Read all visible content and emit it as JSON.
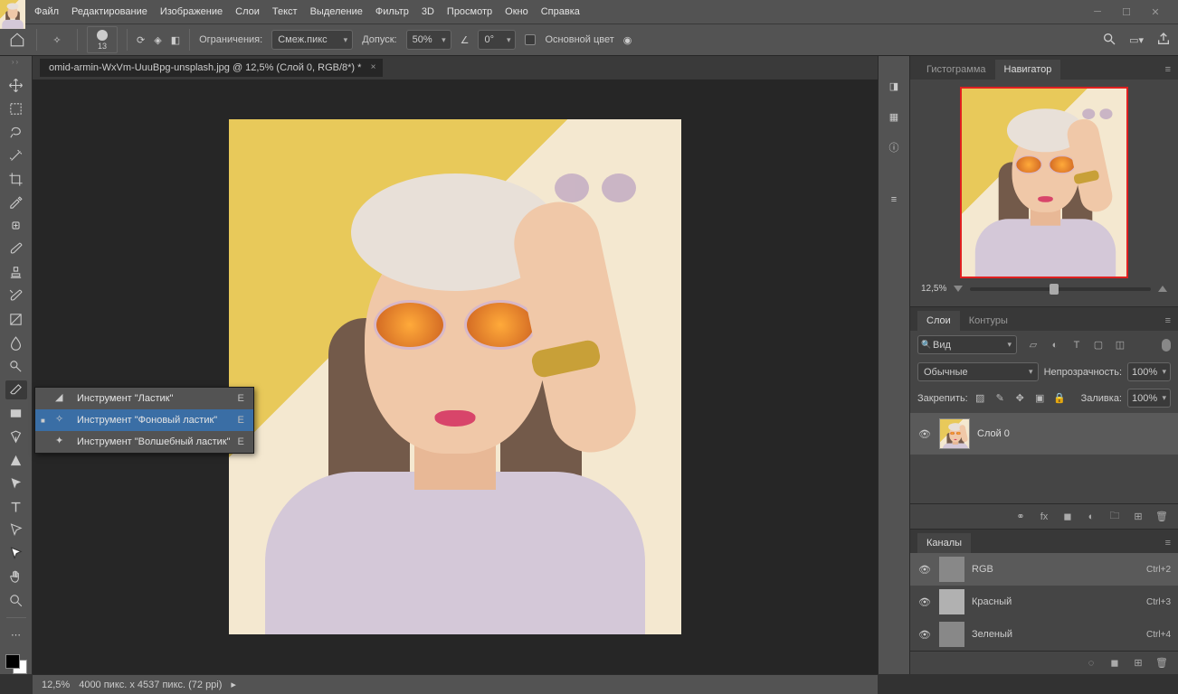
{
  "menu": {
    "items": [
      "Файл",
      "Редактирование",
      "Изображение",
      "Слои",
      "Текст",
      "Выделение",
      "Фильтр",
      "3D",
      "Просмотр",
      "Окно",
      "Справка"
    ]
  },
  "options": {
    "brush_size": "13",
    "limits_label": "Ограничения:",
    "limits_value": "Смеж.пикс",
    "tolerance_label": "Допуск:",
    "tolerance_value": "50%",
    "angle_value": "0°",
    "protect_fg": "Основной цвет"
  },
  "document": {
    "tab_title": "omid-armin-WxVm-UuuBpg-unsplash.jpg @ 12,5% (Слой 0, RGB/8*) *"
  },
  "tool_flyout": {
    "items": [
      {
        "label": "Инструмент \"Ластик\"",
        "key": "E",
        "selected": false
      },
      {
        "label": "Инструмент \"Фоновый ластик\"",
        "key": "E",
        "selected": true
      },
      {
        "label": "Инструмент \"Волшебный ластик\"",
        "key": "E",
        "selected": false
      }
    ]
  },
  "navigator": {
    "tabs": [
      "Гистограмма",
      "Навигатор"
    ],
    "active_tab": 1,
    "zoom": "12,5%"
  },
  "layers": {
    "tabs": [
      "Слои",
      "Контуры"
    ],
    "active_tab": 0,
    "filter_kind": "Вид",
    "blend_mode": "Обычные",
    "opacity_label": "Непрозрачность:",
    "opacity_value": "100%",
    "lock_label": "Закрепить:",
    "fill_label": "Заливка:",
    "fill_value": "100%",
    "items": [
      {
        "name": "Слой 0"
      }
    ]
  },
  "channels": {
    "title": "Каналы",
    "items": [
      {
        "name": "RGB",
        "key": "Ctrl+2",
        "color": true
      },
      {
        "name": "Красный",
        "key": "Ctrl+3",
        "color": false
      },
      {
        "name": "Зеленый",
        "key": "Ctrl+4",
        "color": false
      }
    ]
  },
  "status": {
    "zoom": "12,5%",
    "dims": "4000 пикс. x 4537 пикс. (72 ppi)"
  }
}
